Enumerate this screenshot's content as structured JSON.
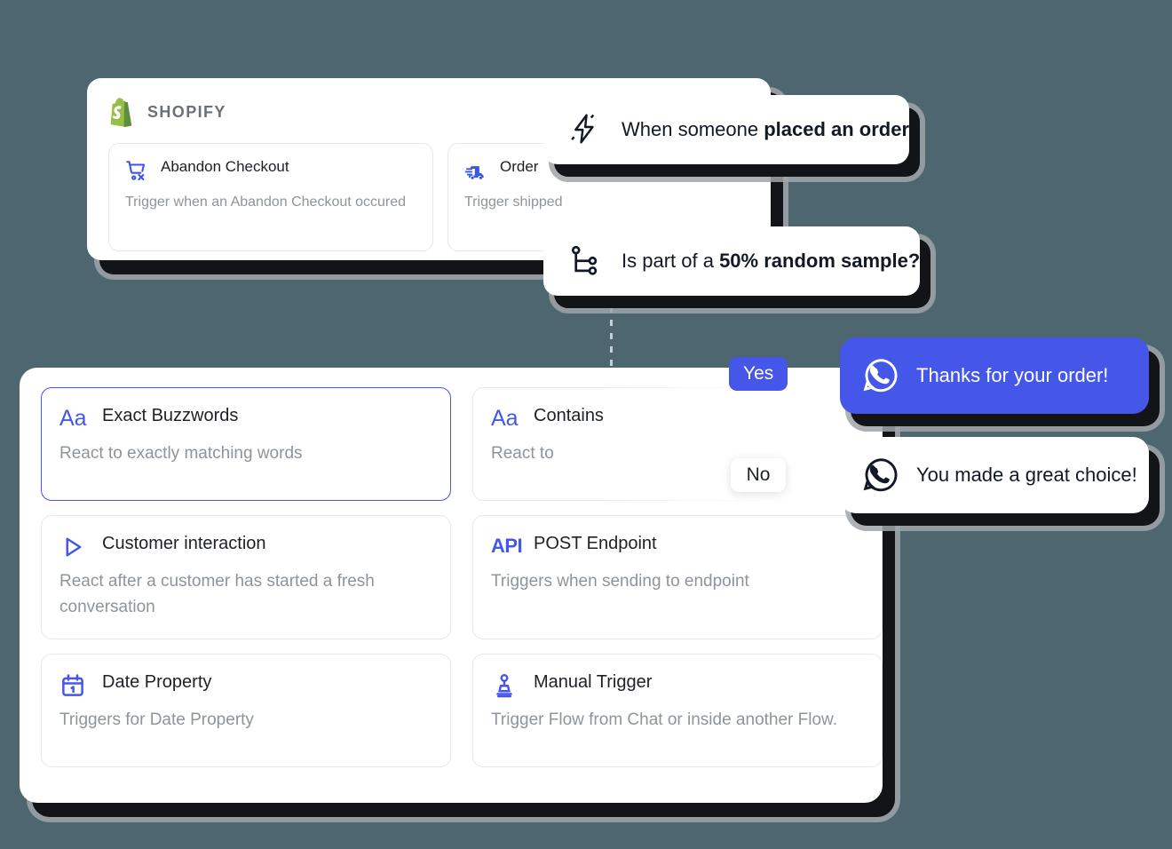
{
  "background_color": "#4d6670",
  "accent_color": "#4557e8",
  "shopify_panel": {
    "brand_label": "SHOPIFY",
    "brand_icon": "shopify-bag-icon",
    "brand_color": "#95BF47",
    "triggers": [
      {
        "icon": "abandoned-cart-icon",
        "title": "Abandon Checkout",
        "description": "Trigger when an Abandon Checkout occured"
      },
      {
        "icon": "delivery-truck-icon",
        "title": "Order",
        "description": "Trigger shipped"
      }
    ]
  },
  "flow": {
    "event_pill": {
      "icon": "lightning-bolt-icon",
      "text_prefix": "When someone ",
      "text_bold": "placed an order"
    },
    "condition_pill": {
      "icon": "branch-split-icon",
      "text_prefix": "Is part of a ",
      "text_bold": "50% random sample?",
      "percent": "50%"
    },
    "branches": [
      {
        "badge": "Yes",
        "badge_style": "primary"
      },
      {
        "badge": "No",
        "badge_style": "default"
      }
    ],
    "messages": [
      {
        "icon": "whatsapp-icon",
        "text": "Thanks for your order!",
        "style": "primary"
      },
      {
        "icon": "whatsapp-icon",
        "text": "You made a great choice!",
        "style": "default"
      }
    ]
  },
  "triggers_panel": {
    "cards": [
      {
        "icon": "text-aa-icon",
        "icon_text": "Aa",
        "title": "Exact Buzzwords",
        "description": "React to exactly matching words",
        "selected": true
      },
      {
        "icon": "text-aa-icon",
        "icon_text": "Aa",
        "title": "Contains",
        "description": "React to",
        "selected": false,
        "truncated": true
      },
      {
        "icon": "play-triangle-icon",
        "title": "Customer interaction",
        "description": "React after a customer has started a fresh conversation",
        "selected": false
      },
      {
        "icon": "api-icon",
        "icon_text": "API",
        "title": "POST Endpoint",
        "description": "Triggers when sending to endpoint",
        "selected": false
      },
      {
        "icon": "calendar-icon",
        "title": "Date Property",
        "description": "Triggers for Date Property",
        "selected": false
      },
      {
        "icon": "stamp-icon",
        "title": "Manual Trigger",
        "description": "Trigger Flow from Chat or inside another Flow.",
        "selected": false
      }
    ]
  }
}
